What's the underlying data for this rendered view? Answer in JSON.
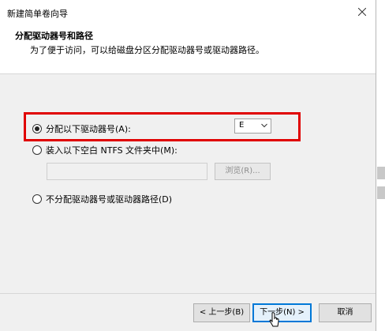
{
  "window": {
    "title": "新建简单卷向导"
  },
  "header": {
    "title": "分配驱动器号和路径",
    "subtitle": "为了便于访问，可以给磁盘分区分配驱动器号或驱动器路径。"
  },
  "options": {
    "assign_letter": {
      "label": "分配以下驱动器号(A):",
      "selected": true
    },
    "drive_letter_value": "E",
    "mount_folder": {
      "label": "装入以下空白 NTFS 文件夹中(M):",
      "selected": false
    },
    "browse_label": "浏览(R)...",
    "no_assign": {
      "label": "不分配驱动器号或驱动器路径(D)",
      "selected": false
    }
  },
  "footer": {
    "back_label": "< 上一步(B)",
    "next_label": "下一步(N) >",
    "cancel_label": "取消"
  },
  "colors": {
    "highlight": "#e00000",
    "focus": "#0078d7"
  }
}
